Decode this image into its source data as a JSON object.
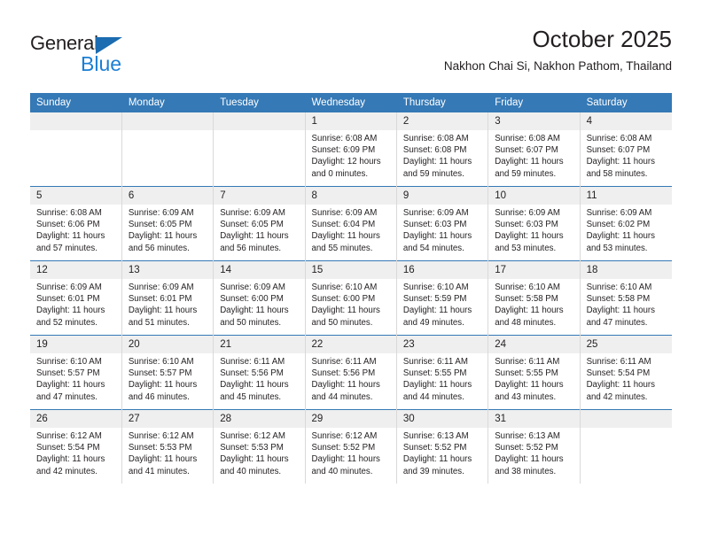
{
  "brand": {
    "name_part1": "General",
    "name_part2": "Blue",
    "triangle_icon": "triangle-icon",
    "color_dark": "#231f20",
    "color_blue": "#1b7fd4"
  },
  "header": {
    "title": "October 2025",
    "subtitle": "Nakhon Chai Si, Nakhon Pathom, Thailand"
  },
  "theme": {
    "header_blue": "#3579b6",
    "daynum_gray": "#efefef",
    "grid_gray": "#d9d9d9"
  },
  "calendar": {
    "weekday_headers": [
      "Sunday",
      "Monday",
      "Tuesday",
      "Wednesday",
      "Thursday",
      "Friday",
      "Saturday"
    ],
    "weeks": [
      [
        {
          "day": "",
          "sunrise": "",
          "sunset": "",
          "daylight_line1": "",
          "daylight_line2": ""
        },
        {
          "day": "",
          "sunrise": "",
          "sunset": "",
          "daylight_line1": "",
          "daylight_line2": ""
        },
        {
          "day": "",
          "sunrise": "",
          "sunset": "",
          "daylight_line1": "",
          "daylight_line2": ""
        },
        {
          "day": "1",
          "sunrise": "Sunrise: 6:08 AM",
          "sunset": "Sunset: 6:09 PM",
          "daylight_line1": "Daylight: 12 hours",
          "daylight_line2": "and 0 minutes."
        },
        {
          "day": "2",
          "sunrise": "Sunrise: 6:08 AM",
          "sunset": "Sunset: 6:08 PM",
          "daylight_line1": "Daylight: 11 hours",
          "daylight_line2": "and 59 minutes."
        },
        {
          "day": "3",
          "sunrise": "Sunrise: 6:08 AM",
          "sunset": "Sunset: 6:07 PM",
          "daylight_line1": "Daylight: 11 hours",
          "daylight_line2": "and 59 minutes."
        },
        {
          "day": "4",
          "sunrise": "Sunrise: 6:08 AM",
          "sunset": "Sunset: 6:07 PM",
          "daylight_line1": "Daylight: 11 hours",
          "daylight_line2": "and 58 minutes."
        }
      ],
      [
        {
          "day": "5",
          "sunrise": "Sunrise: 6:08 AM",
          "sunset": "Sunset: 6:06 PM",
          "daylight_line1": "Daylight: 11 hours",
          "daylight_line2": "and 57 minutes."
        },
        {
          "day": "6",
          "sunrise": "Sunrise: 6:09 AM",
          "sunset": "Sunset: 6:05 PM",
          "daylight_line1": "Daylight: 11 hours",
          "daylight_line2": "and 56 minutes."
        },
        {
          "day": "7",
          "sunrise": "Sunrise: 6:09 AM",
          "sunset": "Sunset: 6:05 PM",
          "daylight_line1": "Daylight: 11 hours",
          "daylight_line2": "and 56 minutes."
        },
        {
          "day": "8",
          "sunrise": "Sunrise: 6:09 AM",
          "sunset": "Sunset: 6:04 PM",
          "daylight_line1": "Daylight: 11 hours",
          "daylight_line2": "and 55 minutes."
        },
        {
          "day": "9",
          "sunrise": "Sunrise: 6:09 AM",
          "sunset": "Sunset: 6:03 PM",
          "daylight_line1": "Daylight: 11 hours",
          "daylight_line2": "and 54 minutes."
        },
        {
          "day": "10",
          "sunrise": "Sunrise: 6:09 AM",
          "sunset": "Sunset: 6:03 PM",
          "daylight_line1": "Daylight: 11 hours",
          "daylight_line2": "and 53 minutes."
        },
        {
          "day": "11",
          "sunrise": "Sunrise: 6:09 AM",
          "sunset": "Sunset: 6:02 PM",
          "daylight_line1": "Daylight: 11 hours",
          "daylight_line2": "and 53 minutes."
        }
      ],
      [
        {
          "day": "12",
          "sunrise": "Sunrise: 6:09 AM",
          "sunset": "Sunset: 6:01 PM",
          "daylight_line1": "Daylight: 11 hours",
          "daylight_line2": "and 52 minutes."
        },
        {
          "day": "13",
          "sunrise": "Sunrise: 6:09 AM",
          "sunset": "Sunset: 6:01 PM",
          "daylight_line1": "Daylight: 11 hours",
          "daylight_line2": "and 51 minutes."
        },
        {
          "day": "14",
          "sunrise": "Sunrise: 6:09 AM",
          "sunset": "Sunset: 6:00 PM",
          "daylight_line1": "Daylight: 11 hours",
          "daylight_line2": "and 50 minutes."
        },
        {
          "day": "15",
          "sunrise": "Sunrise: 6:10 AM",
          "sunset": "Sunset: 6:00 PM",
          "daylight_line1": "Daylight: 11 hours",
          "daylight_line2": "and 50 minutes."
        },
        {
          "day": "16",
          "sunrise": "Sunrise: 6:10 AM",
          "sunset": "Sunset: 5:59 PM",
          "daylight_line1": "Daylight: 11 hours",
          "daylight_line2": "and 49 minutes."
        },
        {
          "day": "17",
          "sunrise": "Sunrise: 6:10 AM",
          "sunset": "Sunset: 5:58 PM",
          "daylight_line1": "Daylight: 11 hours",
          "daylight_line2": "and 48 minutes."
        },
        {
          "day": "18",
          "sunrise": "Sunrise: 6:10 AM",
          "sunset": "Sunset: 5:58 PM",
          "daylight_line1": "Daylight: 11 hours",
          "daylight_line2": "and 47 minutes."
        }
      ],
      [
        {
          "day": "19",
          "sunrise": "Sunrise: 6:10 AM",
          "sunset": "Sunset: 5:57 PM",
          "daylight_line1": "Daylight: 11 hours",
          "daylight_line2": "and 47 minutes."
        },
        {
          "day": "20",
          "sunrise": "Sunrise: 6:10 AM",
          "sunset": "Sunset: 5:57 PM",
          "daylight_line1": "Daylight: 11 hours",
          "daylight_line2": "and 46 minutes."
        },
        {
          "day": "21",
          "sunrise": "Sunrise: 6:11 AM",
          "sunset": "Sunset: 5:56 PM",
          "daylight_line1": "Daylight: 11 hours",
          "daylight_line2": "and 45 minutes."
        },
        {
          "day": "22",
          "sunrise": "Sunrise: 6:11 AM",
          "sunset": "Sunset: 5:56 PM",
          "daylight_line1": "Daylight: 11 hours",
          "daylight_line2": "and 44 minutes."
        },
        {
          "day": "23",
          "sunrise": "Sunrise: 6:11 AM",
          "sunset": "Sunset: 5:55 PM",
          "daylight_line1": "Daylight: 11 hours",
          "daylight_line2": "and 44 minutes."
        },
        {
          "day": "24",
          "sunrise": "Sunrise: 6:11 AM",
          "sunset": "Sunset: 5:55 PM",
          "daylight_line1": "Daylight: 11 hours",
          "daylight_line2": "and 43 minutes."
        },
        {
          "day": "25",
          "sunrise": "Sunrise: 6:11 AM",
          "sunset": "Sunset: 5:54 PM",
          "daylight_line1": "Daylight: 11 hours",
          "daylight_line2": "and 42 minutes."
        }
      ],
      [
        {
          "day": "26",
          "sunrise": "Sunrise: 6:12 AM",
          "sunset": "Sunset: 5:54 PM",
          "daylight_line1": "Daylight: 11 hours",
          "daylight_line2": "and 42 minutes."
        },
        {
          "day": "27",
          "sunrise": "Sunrise: 6:12 AM",
          "sunset": "Sunset: 5:53 PM",
          "daylight_line1": "Daylight: 11 hours",
          "daylight_line2": "and 41 minutes."
        },
        {
          "day": "28",
          "sunrise": "Sunrise: 6:12 AM",
          "sunset": "Sunset: 5:53 PM",
          "daylight_line1": "Daylight: 11 hours",
          "daylight_line2": "and 40 minutes."
        },
        {
          "day": "29",
          "sunrise": "Sunrise: 6:12 AM",
          "sunset": "Sunset: 5:52 PM",
          "daylight_line1": "Daylight: 11 hours",
          "daylight_line2": "and 40 minutes."
        },
        {
          "day": "30",
          "sunrise": "Sunrise: 6:13 AM",
          "sunset": "Sunset: 5:52 PM",
          "daylight_line1": "Daylight: 11 hours",
          "daylight_line2": "and 39 minutes."
        },
        {
          "day": "31",
          "sunrise": "Sunrise: 6:13 AM",
          "sunset": "Sunset: 5:52 PM",
          "daylight_line1": "Daylight: 11 hours",
          "daylight_line2": "and 38 minutes."
        },
        {
          "day": "",
          "sunrise": "",
          "sunset": "",
          "daylight_line1": "",
          "daylight_line2": ""
        }
      ]
    ]
  }
}
